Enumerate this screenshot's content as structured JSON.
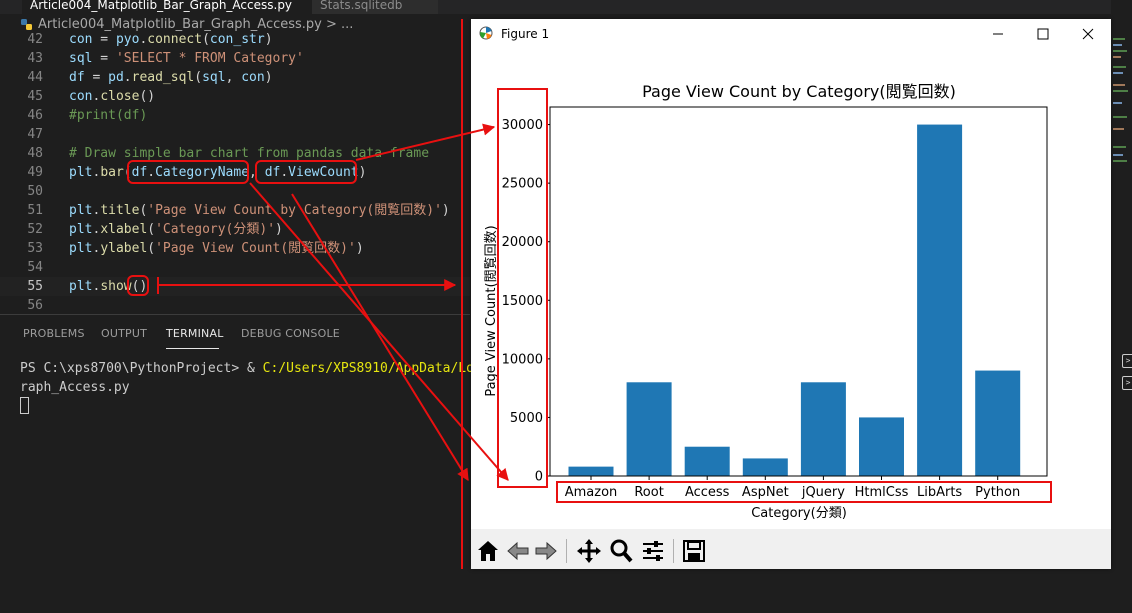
{
  "editor": {
    "tabs": [
      {
        "label": "Article004_Matplotlib_Bar_Graph_Access.py",
        "state": "active"
      },
      {
        "label": "Stats.sqlitedb",
        "state": "inactive"
      }
    ],
    "breadcrumb": "Article004_Matplotlib_Bar_Graph_Access.py > ...",
    "lines": [
      {
        "num": "42",
        "code": "con = pyo.connect(con_str)"
      },
      {
        "num": "43",
        "code": "sql = 'SELECT * FROM Category'"
      },
      {
        "num": "44",
        "code": "df = pd.read_sql(sql, con)"
      },
      {
        "num": "45",
        "code": "con.close()"
      },
      {
        "num": "46",
        "code": "#print(df)"
      },
      {
        "num": "47",
        "code": ""
      },
      {
        "num": "48",
        "code": "# Draw simple bar chart from pandas data frame"
      },
      {
        "num": "49",
        "code": "plt.bar(df.CategoryName, df.ViewCount)"
      },
      {
        "num": "50",
        "code": ""
      },
      {
        "num": "51",
        "code": "plt.title('Page View Count by Category(閲覧回数)')"
      },
      {
        "num": "52",
        "code": "plt.xlabel('Category(分類)')"
      },
      {
        "num": "53",
        "code": "plt.ylabel('Page View Count(閲覧回数)')"
      },
      {
        "num": "54",
        "code": ""
      },
      {
        "num": "55",
        "code": "plt.show()"
      },
      {
        "num": "56",
        "code": ""
      }
    ]
  },
  "panel": {
    "tabs": [
      "PROBLEMS",
      "OUTPUT",
      "TERMINAL",
      "DEBUG CONSOLE"
    ],
    "active_tab": "TERMINAL",
    "terminal": {
      "prompt": "PS C:\\xps8700\\PythonProject> & ",
      "path": "C:/Users/XPS8910/AppData/Local/Pro",
      "line2": "raph_Access.py"
    }
  },
  "figure": {
    "window_title": "Figure 1",
    "toolbar": [
      "home-icon",
      "back-arrow-icon",
      "forward-arrow-icon",
      "pan-icon",
      "zoom-icon",
      "configure-subplots-icon",
      "save-icon"
    ]
  },
  "colors": {
    "bar": "#1f77b4",
    "annotation": "#e81010"
  },
  "chart_data": {
    "type": "bar",
    "title": "Page View Count by Category(閲覧回数)",
    "xlabel": "Category(分類)",
    "ylabel": "Page View Count(閲覧回数)",
    "categories": [
      "Amazon",
      "Root",
      "Access",
      "AspNet",
      "jQuery",
      "HtmlCss",
      "LibArts",
      "Python"
    ],
    "values": [
      800,
      8000,
      2500,
      1500,
      8000,
      5000,
      30000,
      9000
    ],
    "ylim": [
      0,
      31500
    ],
    "yticks": [
      0,
      5000,
      10000,
      15000,
      20000,
      25000,
      30000
    ],
    "grid": false
  }
}
